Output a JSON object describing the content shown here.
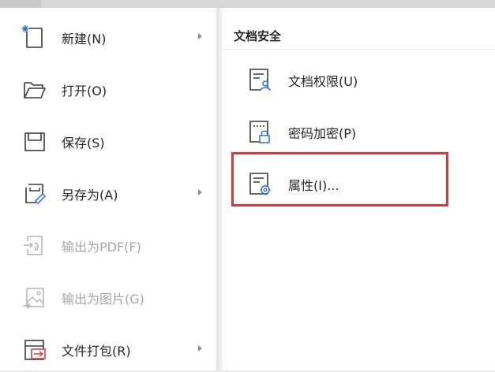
{
  "left_menu": {
    "items": [
      {
        "label": "新建(N)",
        "icon": "new-file-icon",
        "has_submenu": true,
        "enabled": true
      },
      {
        "label": "打开(O)",
        "icon": "open-folder-icon",
        "has_submenu": false,
        "enabled": true
      },
      {
        "label": "保存(S)",
        "icon": "save-icon",
        "has_submenu": false,
        "enabled": true
      },
      {
        "label": "另存为(A)",
        "icon": "save-as-icon",
        "has_submenu": true,
        "enabled": true
      },
      {
        "label": "输出为PDF(F)",
        "icon": "export-pdf-icon",
        "has_submenu": false,
        "enabled": false
      },
      {
        "label": "输出为图片(G)",
        "icon": "export-image-icon",
        "has_submenu": false,
        "enabled": false
      },
      {
        "label": "文件打包(R)",
        "icon": "file-package-icon",
        "has_submenu": true,
        "enabled": true
      }
    ]
  },
  "submenu": {
    "title": "文档安全",
    "items": [
      {
        "label": "文档权限(U)",
        "icon": "document-permission-icon"
      },
      {
        "label": "密码加密(P)",
        "icon": "password-encrypt-icon"
      },
      {
        "label": "属性(I)...",
        "icon": "document-properties-icon",
        "highlighted": true
      }
    ]
  },
  "colors": {
    "highlight_border": "#d9393b",
    "text": "#262626",
    "disabled_text": "#a6a6a6",
    "icon_stroke": "#3a3a3a",
    "accent_blue": "#2f6fd6"
  }
}
